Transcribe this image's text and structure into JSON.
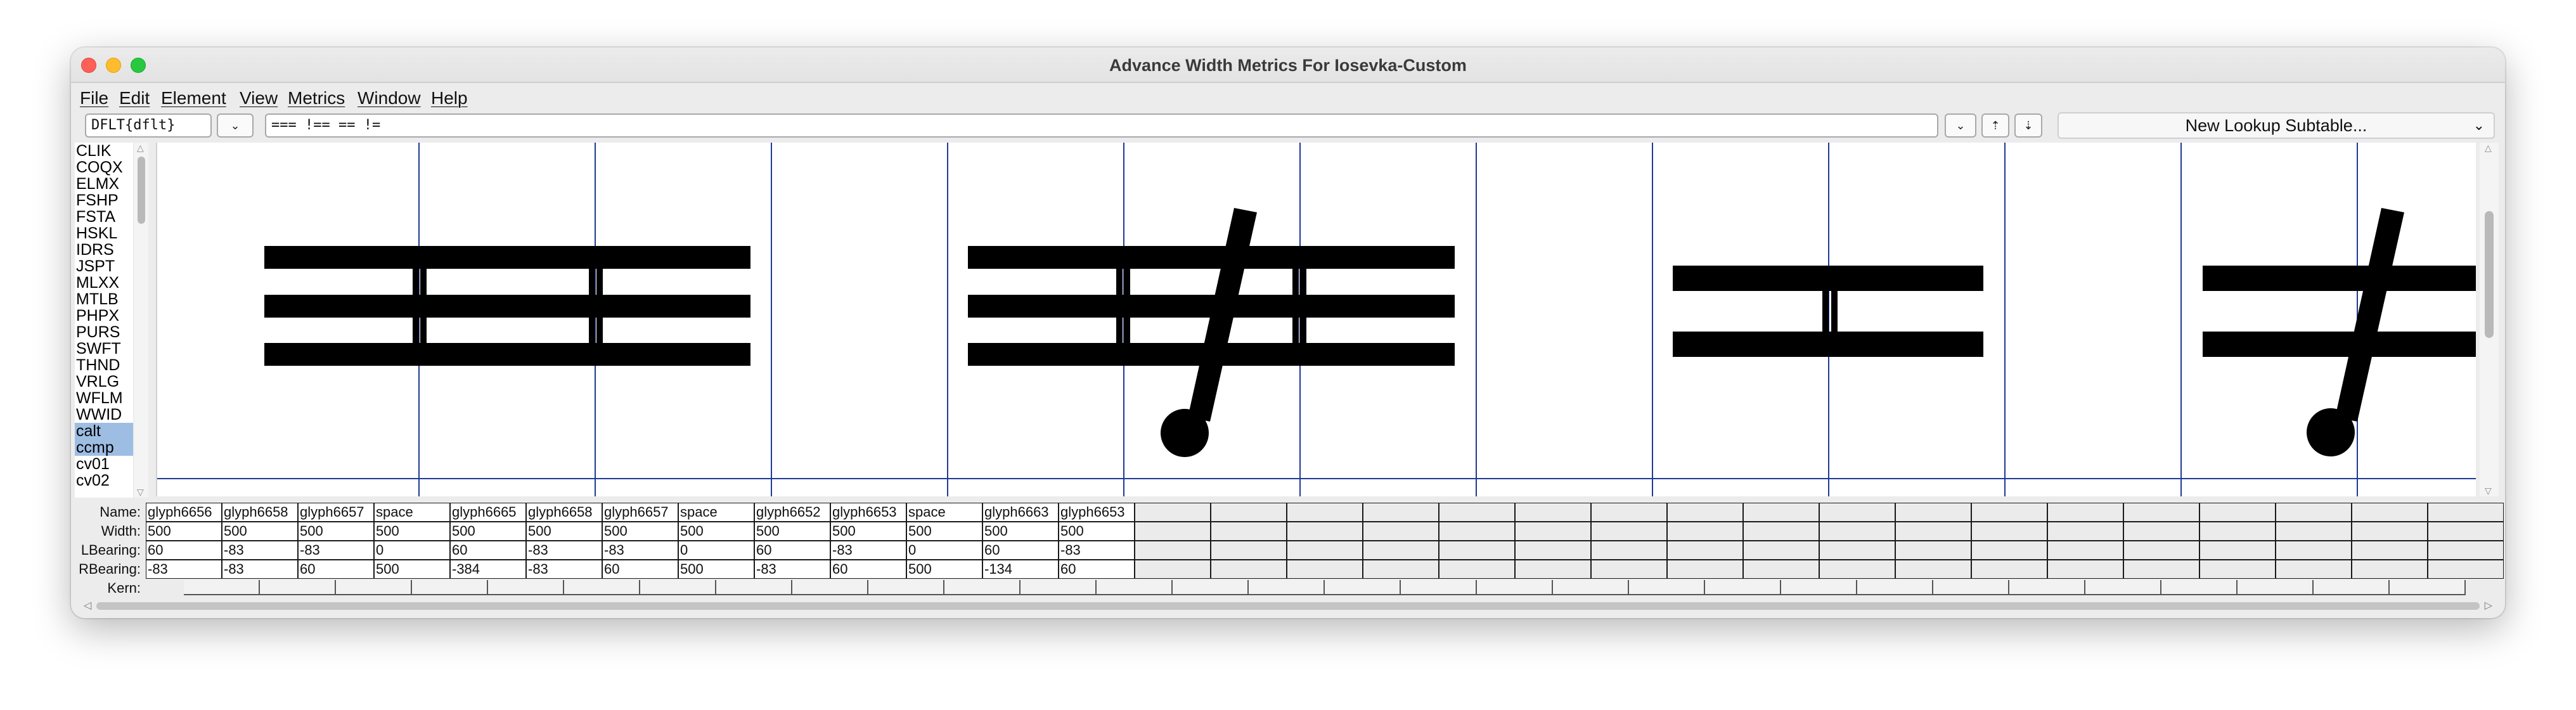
{
  "window": {
    "title": "Advance Width Metrics For Iosevka-Custom"
  },
  "menu": [
    "File",
    "Edit",
    "Element",
    "View",
    "Metrics",
    "Window",
    "Help"
  ],
  "toolbar": {
    "script_value": "DFLT{dflt}",
    "text_value": "=== !== == !=",
    "subtable_label": "New Lookup Subtable...",
    "dropdown_glyph": "⌄",
    "up_glyph": "⇡",
    "down_glyph": "⇣"
  },
  "features": [
    "CLIK",
    "COQX",
    "ELMX",
    "FSHP",
    "FSTA",
    "HSKL",
    "IDRS",
    "JSPT",
    "MLXX",
    "MTLB",
    "PHPX",
    "PURS",
    "SWFT",
    "THND",
    "VRLG",
    "WFLM",
    "WWID",
    "calt",
    "ccmp",
    "cv01",
    "cv02"
  ],
  "selected_features": [
    "calt",
    "ccmp"
  ],
  "metrics": {
    "labels": {
      "name": "Name:",
      "width": "Width:",
      "lbearing": "LBearing:",
      "rbearing": "RBearing:",
      "kern": "Kern:"
    },
    "glyphs": [
      {
        "name": "glyph6656",
        "width": "500",
        "lbearing": "60",
        "rbearing": "-83"
      },
      {
        "name": "glyph6658",
        "width": "500",
        "lbearing": "-83",
        "rbearing": "-83"
      },
      {
        "name": "glyph6657",
        "width": "500",
        "lbearing": "-83",
        "rbearing": "60"
      },
      {
        "name": "space",
        "width": "500",
        "lbearing": "0",
        "rbearing": "500"
      },
      {
        "name": "glyph6665",
        "width": "500",
        "lbearing": "60",
        "rbearing": "-384"
      },
      {
        "name": "glyph6658",
        "width": "500",
        "lbearing": "-83",
        "rbearing": "-83"
      },
      {
        "name": "glyph6657",
        "width": "500",
        "lbearing": "-83",
        "rbearing": "60"
      },
      {
        "name": "space",
        "width": "500",
        "lbearing": "0",
        "rbearing": "500"
      },
      {
        "name": "glyph6652",
        "width": "500",
        "lbearing": "60",
        "rbearing": "-83"
      },
      {
        "name": "glyph6653",
        "width": "500",
        "lbearing": "-83",
        "rbearing": "60"
      },
      {
        "name": "space",
        "width": "500",
        "lbearing": "0",
        "rbearing": "500"
      },
      {
        "name": "glyph6663",
        "width": "500",
        "lbearing": "60",
        "rbearing": "-134"
      },
      {
        "name": "glyph6653",
        "width": "500",
        "lbearing": "-83",
        "rbearing": "60"
      }
    ]
  },
  "colors": {
    "guide_line": "#1f3a93",
    "glyph_fill": "#000000",
    "selection": "#9dbde3"
  }
}
